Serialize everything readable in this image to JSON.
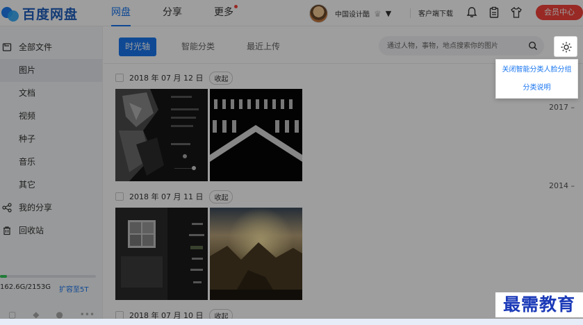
{
  "app": {
    "logo_text": "百度网盘"
  },
  "topnav": {
    "items": [
      {
        "label": "网盘",
        "active": true
      },
      {
        "label": "分享",
        "active": false
      },
      {
        "label": "更多",
        "active": false,
        "badge_dot": true
      }
    ],
    "username": "中国设计酷",
    "client_download": "客户端下载",
    "vip_button": "会员中心"
  },
  "sidebar": {
    "items": [
      {
        "label": "全部文件",
        "icon": "folder-icon"
      },
      {
        "label": "图片",
        "active": true
      },
      {
        "label": "文档"
      },
      {
        "label": "视频"
      },
      {
        "label": "种子"
      },
      {
        "label": "音乐"
      },
      {
        "label": "其它"
      },
      {
        "label": "我的分享",
        "icon": "share-icon"
      },
      {
        "label": "回收站",
        "icon": "trash-icon"
      }
    ],
    "storage": {
      "used_text": "162.6G/2153G",
      "expand_label": "扩容至5T",
      "used_fraction": 0.0755
    }
  },
  "toolbar": {
    "tabs": [
      {
        "label": "时光轴",
        "active": true
      },
      {
        "label": "智能分类"
      },
      {
        "label": "最近上传"
      }
    ],
    "search_placeholder": "通过人物，事物，地点搜索你的图片"
  },
  "settings_menu": {
    "items": [
      "关闭智能分类人脸分组",
      "分类说明"
    ]
  },
  "timeline": {
    "groups": [
      {
        "date": "2018 年 07 月 12 日",
        "fold_label": "收起"
      },
      {
        "date": "2018 年 07 月 11 日",
        "fold_label": "收起"
      },
      {
        "date": "2018 年 07 月 10 日",
        "fold_label": "收起"
      }
    ],
    "years": [
      "2017 –",
      "2014 –"
    ]
  },
  "watermark": "最需教育"
}
